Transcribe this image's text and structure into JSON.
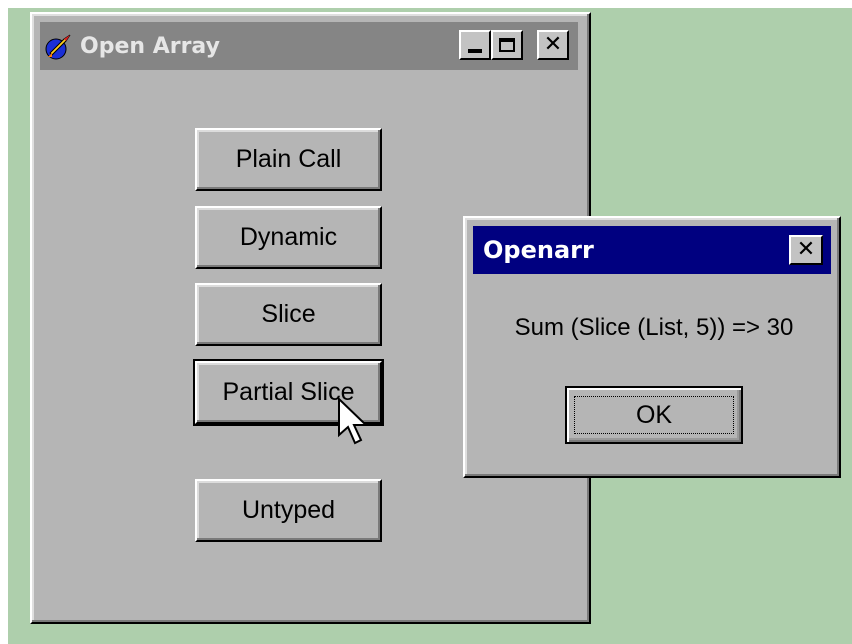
{
  "main_window": {
    "title": "Open Array",
    "icon": "app-rocket-icon",
    "caption_buttons": [
      "minimize-icon",
      "maximize-icon",
      "close-icon"
    ],
    "buttons": {
      "plain_call": "Plain Call",
      "dynamic": "Dynamic",
      "slice": "Slice",
      "partial_slice": "Partial Slice",
      "untyped": "Untyped"
    }
  },
  "dialog": {
    "title": "Openarr",
    "message": "Sum (Slice (List, 5)) => 30",
    "ok_label": "OK"
  },
  "colors": {
    "desktop": "#aecfac",
    "window_face": "#b5b5b5",
    "inactive_title": "#858585",
    "active_title": "#000080"
  }
}
